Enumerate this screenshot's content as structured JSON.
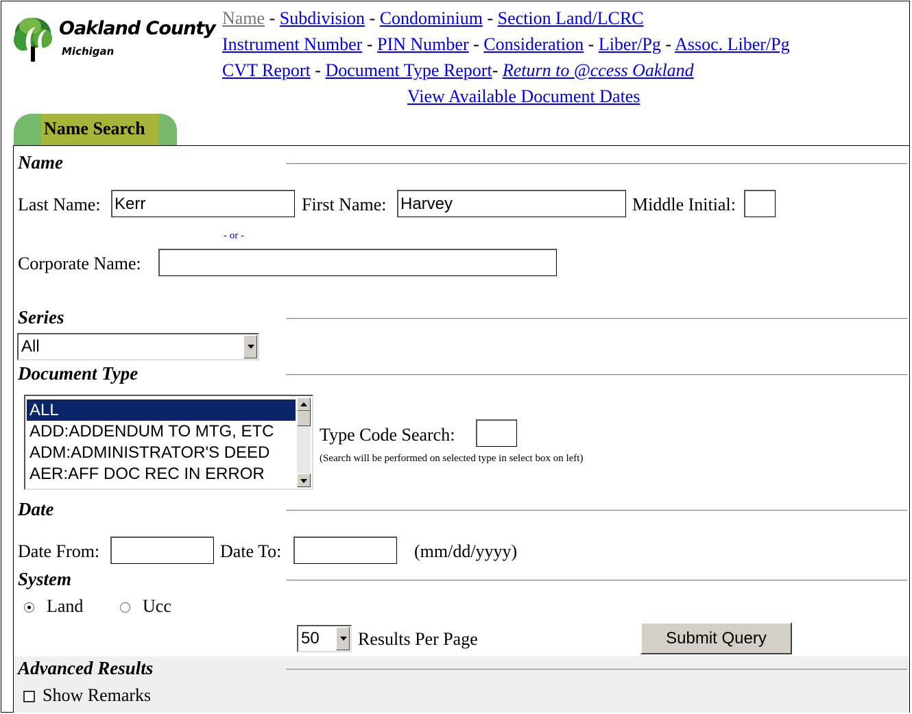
{
  "logo": {
    "title": "Oakland County",
    "subtitle": "Michigan"
  },
  "nav": {
    "row1": [
      {
        "label": "Name",
        "current": true
      },
      {
        "label": "Subdivision"
      },
      {
        "label": "Condominium"
      },
      {
        "label": "Section Land/LCRC"
      }
    ],
    "row2": [
      {
        "label": "Instrument Number"
      },
      {
        "label": "PIN Number"
      },
      {
        "label": "Consideration"
      },
      {
        "label": "Liber/Pg"
      },
      {
        "label": "Assoc. Liber/Pg"
      }
    ],
    "row3": [
      {
        "label": "CVT Report"
      },
      {
        "label": "Document Type Report"
      },
      {
        "label": "Return to @ccess Oakland"
      }
    ],
    "row4": [
      {
        "label": "View Available Document Dates"
      }
    ]
  },
  "tab": {
    "label": "Name Search"
  },
  "name_section": {
    "heading": "Name",
    "last_name_label": "Last Name:",
    "last_name_value": "Kerr",
    "first_name_label": "First Name:",
    "first_name_value": "Harvey",
    "middle_initial_label": "Middle Initial:",
    "middle_initial_value": "",
    "or_text": "- or -",
    "corporate_name_label": "Corporate Name:",
    "corporate_name_value": ""
  },
  "series_section": {
    "heading": "Series",
    "selected": "All"
  },
  "doctype_section": {
    "heading": "Document Type",
    "options": [
      "ALL",
      "ADD:ADDENDUM TO MTG, ETC",
      "ADM:ADMINISTRATOR'S DEED",
      "AER:AFF DOC REC IN ERROR"
    ],
    "selected_index": 0,
    "type_code_label": "Type Code Search:",
    "type_code_value": "",
    "type_code_note": "(Search will be performed on selected type in select box on left)"
  },
  "date_section": {
    "heading": "Date",
    "from_label": "Date From:",
    "from_value": "",
    "to_label": "Date To:",
    "to_value": "",
    "format_hint": "(mm/dd/yyyy)"
  },
  "system_section": {
    "heading": "System",
    "options": [
      {
        "label": "Land",
        "checked": true
      },
      {
        "label": "Ucc",
        "checked": false
      }
    ]
  },
  "results": {
    "per_page_value": "50",
    "per_page_label": "Results Per Page",
    "submit_label": "Submit Query"
  },
  "advanced_section": {
    "heading": "Advanced Results",
    "show_remarks_label": "Show Remarks",
    "show_remarks_checked": false
  },
  "colors": {
    "link": "#0000ee",
    "tab_green": "#76b96b",
    "tab_olive": "#a6b53a",
    "selection": "#0a246a"
  }
}
